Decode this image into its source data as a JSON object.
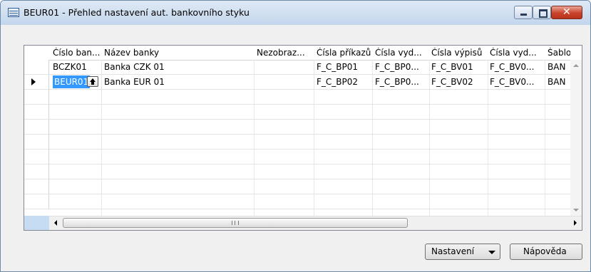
{
  "window": {
    "title": "BEUR01 - Přehled nastavení aut. bankovního styku",
    "icon": "grid-form-icon",
    "accent": "#3399ff"
  },
  "grid": {
    "columns": [
      {
        "label": "Číslo ban..."
      },
      {
        "label": "Název banky"
      },
      {
        "label": "Nezobraz..."
      },
      {
        "label": "Čísla příkazů"
      },
      {
        "label": "Čísla vyd..."
      },
      {
        "label": "Čísla výpisů"
      },
      {
        "label": "Čísla vyd..."
      },
      {
        "label": "Šablo"
      }
    ],
    "rows": [
      {
        "cells": [
          "BCZK01",
          "Banka CZK 01",
          "",
          "F_C_BP01",
          "F_C_BP0...",
          "F_C_BV01",
          "F_C_BV0...",
          "BAN"
        ]
      },
      {
        "cells": [
          "BEUR01",
          "Banka EUR 01",
          "",
          "F_C_BP02",
          "F_C_BP0...",
          "F_C_BV02",
          "F_C_BV0...",
          "BAN"
        ]
      }
    ],
    "scroll_grip": "III"
  },
  "buttons": {
    "setup": "Nastavení",
    "help": "Nápověda"
  }
}
